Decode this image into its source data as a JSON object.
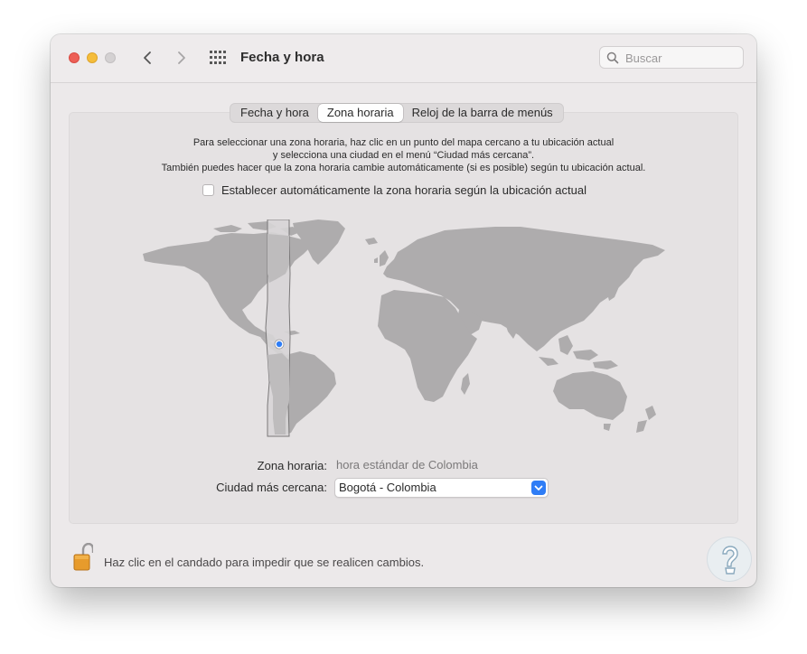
{
  "window": {
    "title": "Fecha y hora",
    "search_placeholder": "Buscar"
  },
  "tabs": [
    {
      "label": "Fecha y hora",
      "selected": false
    },
    {
      "label": "Zona horaria",
      "selected": true
    },
    {
      "label": "Reloj de la barra de menús",
      "selected": false
    }
  ],
  "instructions": {
    "line1": "Para seleccionar una zona horaria, haz clic en un punto del mapa cercano a tu ubicación actual",
    "line2": "y selecciona una ciudad en el menú “Ciudad más cercana”.",
    "line3": "También puedes hacer que la zona horaria cambie automáticamente (si es posible) según tu ubicación actual."
  },
  "auto_timezone": {
    "label": "Establecer automáticamente la zona horaria según la ubicación actual",
    "checked": false
  },
  "timezone": {
    "label": "Zona horaria:",
    "value": "hora estándar de Colombia"
  },
  "closest_city": {
    "label": "Ciudad más cercana:",
    "value": "Bogotá - Colombia"
  },
  "lock": {
    "text": "Haz clic en el candado para impedir que se realicen cambios.",
    "state": "unlocked"
  },
  "colors": {
    "land": "#aeacad",
    "selected_zone": "#d7d5d6",
    "accent": "#2f7df6",
    "close": "#ed5f56",
    "minimize": "#f5bd3b"
  }
}
